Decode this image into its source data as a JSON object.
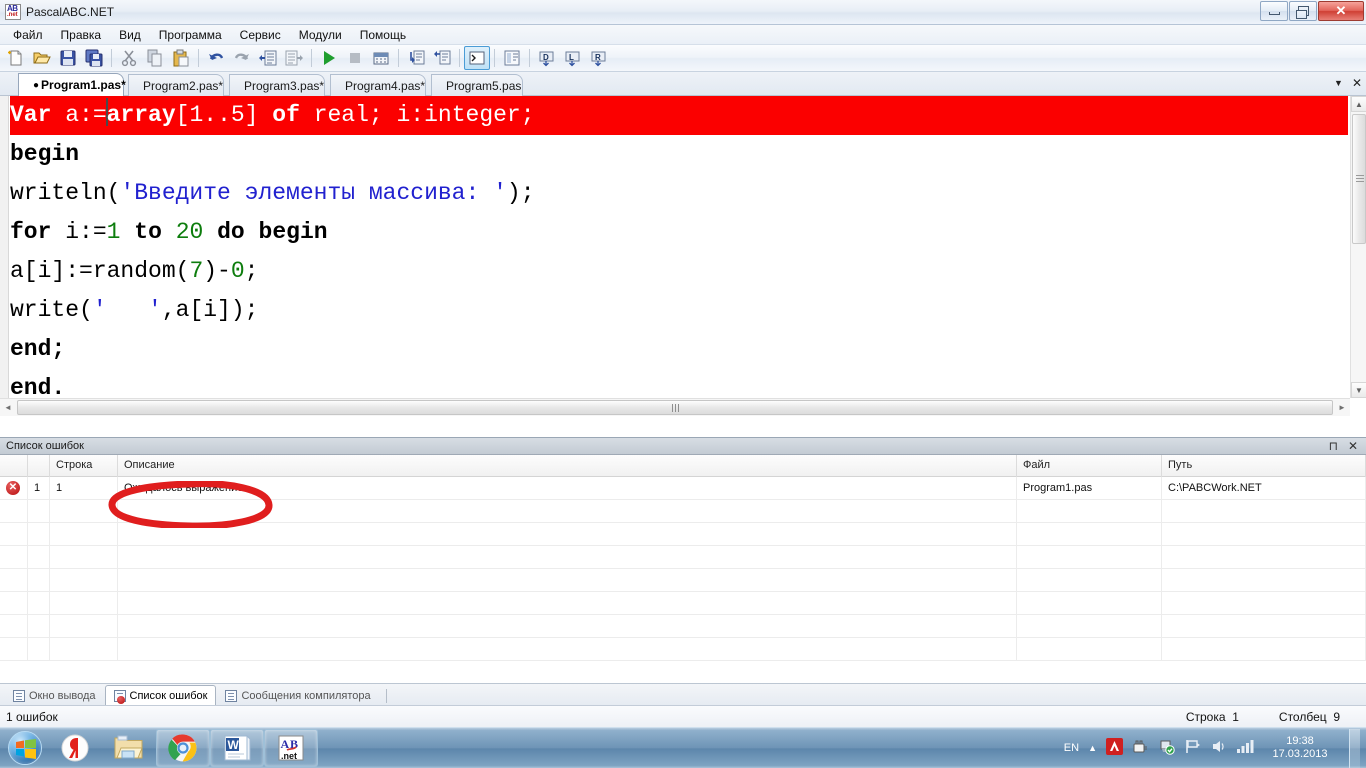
{
  "window": {
    "title": "PascalABC.NET",
    "app_icon": "pascalabc-icon",
    "buttons": {
      "minimize": "minimize",
      "maximize": "maximize",
      "close": "✕"
    }
  },
  "menu": {
    "items": [
      {
        "label": "Файл",
        "name": "menu-file"
      },
      {
        "label": "Правка",
        "name": "menu-edit"
      },
      {
        "label": "Вид",
        "name": "menu-view"
      },
      {
        "label": "Программа",
        "name": "menu-program"
      },
      {
        "label": "Сервис",
        "name": "menu-service"
      },
      {
        "label": "Модули",
        "name": "menu-modules"
      },
      {
        "label": "Помощь",
        "name": "menu-help"
      }
    ]
  },
  "toolbar": {
    "buttons": [
      "new-file-icon",
      "open-file-icon",
      "save-icon",
      "save-all-icon",
      "cut-icon",
      "copy-icon",
      "paste-icon",
      "undo-icon",
      "redo-icon",
      "indent-left-icon",
      "indent-right-icon",
      "run-icon",
      "stop-icon",
      "build-icon",
      "comment-block-icon",
      "uncomment-block-icon",
      "console-icon",
      "form-icon",
      "debug-d-icon",
      "debug-l-icon",
      "debug-r-icon"
    ],
    "active_button": "console-icon"
  },
  "file_tabs": {
    "items": [
      {
        "label": "Program1.pas*",
        "modified_dot": "●",
        "selected": true
      },
      {
        "label": "Program2.pas*",
        "selected": false
      },
      {
        "label": "Program3.pas*",
        "selected": false
      },
      {
        "label": "Program4.pas*",
        "selected": false
      },
      {
        "label": "Program5.pas",
        "selected": false
      }
    ],
    "dropdown_icon": "chevron-down-icon",
    "close_icon": "✕"
  },
  "editor": {
    "error_line_bg": "#fb0000",
    "lines": [
      {
        "error": true,
        "tokens": [
          {
            "t": "Var",
            "k": "kw-w"
          },
          {
            "t": " a:=",
            "k": "plain-w"
          },
          {
            "t": "CARET",
            "k": "caret"
          },
          {
            "t": "array",
            "k": "kw-w"
          },
          {
            "t": "[1..5] ",
            "k": "plain-w"
          },
          {
            "t": "of",
            "k": "kw-w"
          },
          {
            "t": " real; i:integer;",
            "k": "plain-w"
          }
        ]
      },
      {
        "error": false,
        "tokens": [
          {
            "t": "begin",
            "k": "kw"
          }
        ]
      },
      {
        "error": false,
        "tokens": [
          {
            "t": "writeln(",
            "k": ""
          },
          {
            "t": "'Введите элементы массива: '",
            "k": "str"
          },
          {
            "t": ");",
            "k": ""
          }
        ]
      },
      {
        "error": false,
        "tokens": [
          {
            "t": "for",
            "k": "kw"
          },
          {
            "t": " i:=",
            "k": ""
          },
          {
            "t": "1",
            "k": "num"
          },
          {
            "t": " ",
            "k": ""
          },
          {
            "t": "to",
            "k": "kw"
          },
          {
            "t": " ",
            "k": ""
          },
          {
            "t": "20",
            "k": "num"
          },
          {
            "t": " ",
            "k": ""
          },
          {
            "t": "do",
            "k": "kw"
          },
          {
            "t": " ",
            "k": ""
          },
          {
            "t": "begin",
            "k": "kw"
          }
        ]
      },
      {
        "error": false,
        "tokens": [
          {
            "t": "a[i]:=random(",
            "k": ""
          },
          {
            "t": "7",
            "k": "num"
          },
          {
            "t": ")-",
            "k": ""
          },
          {
            "t": "0",
            "k": "num"
          },
          {
            "t": ";",
            "k": ""
          }
        ]
      },
      {
        "error": false,
        "tokens": [
          {
            "t": "write(",
            "k": ""
          },
          {
            "t": "'   '",
            "k": "str"
          },
          {
            "t": ",a[i]);",
            "k": ""
          }
        ]
      },
      {
        "error": false,
        "tokens": [
          {
            "t": "end;",
            "k": "kw"
          }
        ]
      },
      {
        "error": false,
        "tokens": [
          {
            "t": "end.",
            "k": "kw"
          }
        ]
      }
    ]
  },
  "error_panel": {
    "title": "Список ошибок",
    "pin_icon": "pin-icon",
    "close_icon": "✕",
    "columns": [
      "",
      "",
      "Строка",
      "Описание",
      "Файл",
      "Путь"
    ],
    "rows": [
      {
        "icon": "error-icon",
        "num": "1",
        "line": "1",
        "description": "Ожидалось выражение",
        "file": "Program1.pas",
        "path": "C:\\PABCWork.NET"
      }
    ],
    "empty_rows": 7,
    "annotation": {
      "shape": "hand-drawn-ellipse",
      "color": "#e02020"
    }
  },
  "bottom_tabs": {
    "items": [
      {
        "label": "Окно вывода",
        "icon": "output-window-icon",
        "selected": false
      },
      {
        "label": "Список ошибок",
        "icon": "error-list-icon",
        "selected": true
      },
      {
        "label": "Сообщения компилятора",
        "icon": "compiler-messages-icon",
        "selected": false
      }
    ]
  },
  "status_bar": {
    "message": "1 ошибок",
    "row_label": "Строка",
    "row_value": "1",
    "col_label": "Столбец",
    "col_value": "9"
  },
  "taskbar": {
    "start": "start-orb",
    "items": [
      {
        "name": "yandex-browser-icon",
        "framed": false
      },
      {
        "name": "file-explorer-icon",
        "framed": false
      },
      {
        "name": "google-chrome-icon",
        "framed": true
      },
      {
        "name": "microsoft-word-icon",
        "framed": true
      },
      {
        "name": "pascalabc-icon",
        "framed": true
      }
    ],
    "tray": {
      "language": "EN",
      "expand_icon": "chevron-up-icon",
      "icons": [
        "avira-icon",
        "safely-remove-icon",
        "update-shield-icon",
        "action-center-flag-icon",
        "volume-icon",
        "network-icon"
      ],
      "time": "19:38",
      "date": "17.03.2013"
    }
  }
}
